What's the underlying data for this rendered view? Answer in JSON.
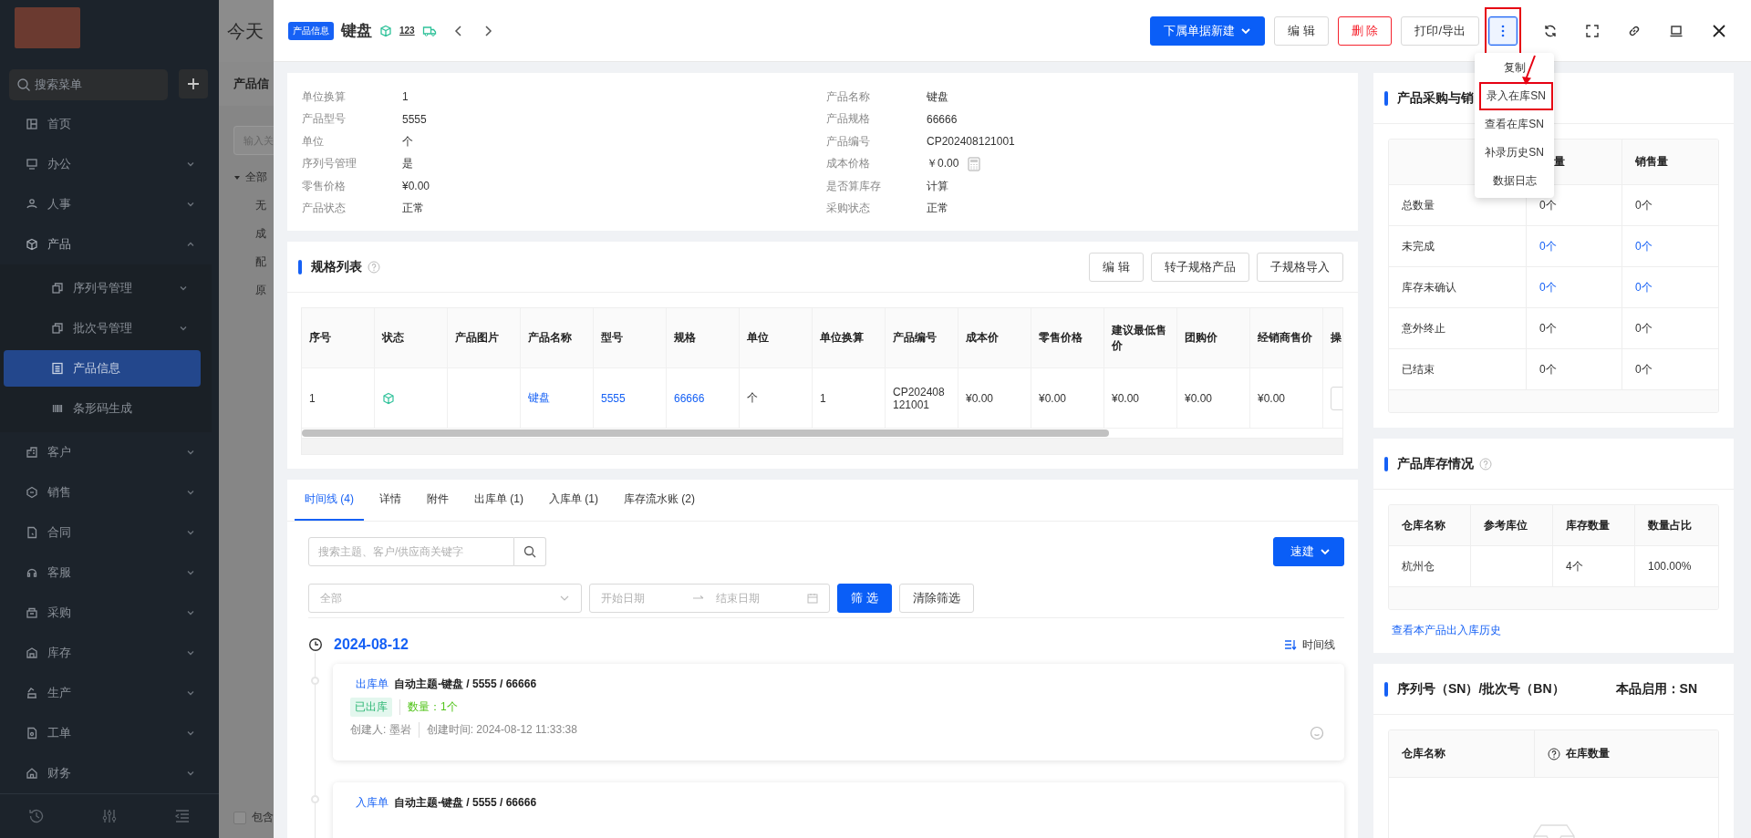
{
  "sidebar": {
    "search": {
      "placeholder": "搜索菜单"
    },
    "items": [
      {
        "label": "首页",
        "selected": false
      },
      {
        "label": "办公",
        "expanded": false,
        "selected": false
      },
      {
        "label": "人事",
        "expanded": false,
        "selected": false
      },
      {
        "label": "产品",
        "expanded": true,
        "selected": false,
        "children": [
          {
            "label": "序列号管理",
            "expanded": false,
            "selected": false
          },
          {
            "label": "批次号管理",
            "expanded": false,
            "selected": false
          },
          {
            "label": "产品信息",
            "selected": true
          },
          {
            "label": "条形码生成",
            "selected": false
          }
        ]
      },
      {
        "label": "客户",
        "expanded": false,
        "selected": false
      },
      {
        "label": "销售",
        "expanded": false,
        "selected": false
      },
      {
        "label": "合同",
        "expanded": false,
        "selected": false
      },
      {
        "label": "客服",
        "expanded": false,
        "selected": false
      },
      {
        "label": "采购",
        "expanded": false,
        "selected": false
      },
      {
        "label": "库存",
        "expanded": false,
        "selected": false
      },
      {
        "label": "生产",
        "expanded": false,
        "selected": false
      },
      {
        "label": "工单",
        "expanded": false,
        "selected": false
      },
      {
        "label": "财务",
        "expanded": false,
        "selected": false
      }
    ]
  },
  "background_page": {
    "title": "今天",
    "section": "产品信",
    "search": {
      "placeholder": "输入关"
    },
    "tree": {
      "label": "全部",
      "expanded": true,
      "children": [
        {
          "label": "无"
        },
        {
          "label": "成"
        },
        {
          "label": "配"
        },
        {
          "label": "原"
        }
      ]
    },
    "checkbox": {
      "label": "包含",
      "checked": false
    }
  },
  "drawer": {
    "header": {
      "tag": "产品信息",
      "title": "键盘",
      "code_badge": "123",
      "actions": [
        {
          "label": "下属单据新建",
          "kind": "primary-dropdown"
        },
        {
          "label": "编 辑",
          "kind": "default"
        },
        {
          "label": "删 除",
          "kind": "danger"
        },
        {
          "label": "打印/导出",
          "kind": "default"
        }
      ],
      "more": {
        "highlighted": true
      }
    },
    "more_menu": {
      "arrow": true,
      "items": [
        {
          "label": "复制",
          "highlighted": false
        },
        {
          "label": "录入在库SN",
          "highlighted": true
        },
        {
          "label": "查看在库SN",
          "highlighted": false
        },
        {
          "label": "补录历史SN",
          "highlighted": false
        },
        {
          "label": "数据日志",
          "highlighted": false
        }
      ]
    },
    "info": {
      "left": [
        {
          "label": "单位换算",
          "value": "1"
        },
        {
          "label": "产品型号",
          "value": "5555"
        },
        {
          "label": "单位",
          "value": "个"
        },
        {
          "label": "序列号管理",
          "value": "是"
        },
        {
          "label": "零售价格",
          "value": "¥0.00"
        },
        {
          "label": "产品状态",
          "value": "正常"
        }
      ],
      "right": [
        {
          "label": "产品名称",
          "value": "键盘"
        },
        {
          "label": "产品规格",
          "value": "66666"
        },
        {
          "label": "产品编号",
          "value": "CP202408121001"
        },
        {
          "label": "成本价格",
          "value": "￥0.00",
          "calculator": true
        },
        {
          "label": "是否算库存",
          "value": "计算"
        },
        {
          "label": "采购状态",
          "value": "正常"
        }
      ]
    },
    "spec_list": {
      "title": "规格列表",
      "buttons": [
        "编 辑",
        "转子规格产品",
        "子规格导入"
      ],
      "columns": [
        "序号",
        "状态",
        "产品图片",
        "产品名称",
        "型号",
        "规格",
        "单位",
        "单位换算",
        "产品编号",
        "成本价",
        "零售价格",
        "建议最低售价",
        "团购价",
        "经销商售价",
        "操"
      ],
      "rows": [
        [
          {
            "kind": "text",
            "text": "1"
          },
          {
            "kind": "status-icon"
          },
          {
            "kind": "empty"
          },
          {
            "kind": "link",
            "text": "键盘"
          },
          {
            "kind": "link",
            "text": "5555"
          },
          {
            "kind": "link",
            "text": "66666"
          },
          {
            "kind": "text",
            "text": "个"
          },
          {
            "kind": "text",
            "text": "1"
          },
          {
            "kind": "text",
            "text": "CP202408121001"
          },
          {
            "kind": "text",
            "text": "¥0.00"
          },
          {
            "kind": "text",
            "text": "¥0.00"
          },
          {
            "kind": "text",
            "text": "¥0.00"
          },
          {
            "kind": "text",
            "text": "¥0.00"
          },
          {
            "kind": "text",
            "text": "¥0.00"
          },
          {
            "kind": "button"
          }
        ]
      ]
    },
    "tabs": [
      {
        "label": "时间线 (4)",
        "selected": true
      },
      {
        "label": "详情",
        "selected": false
      },
      {
        "label": "附件",
        "selected": false
      },
      {
        "label": "出库单 (1)",
        "selected": false
      },
      {
        "label": "入库单 (1)",
        "selected": false
      },
      {
        "label": "库存流水账 (2)",
        "selected": false
      }
    ],
    "timeline": {
      "search": {
        "placeholder": "搜索主题、客户/供应商关键字"
      },
      "quick_create": "速建",
      "type_filter": {
        "placeholder": "全部"
      },
      "date_start": {
        "placeholder": "开始日期"
      },
      "date_end": {
        "placeholder": "结束日期"
      },
      "filter_button": "筛 选",
      "clear_button": "清除筛选",
      "date": "2024-08-12",
      "view_toggle": "时间线",
      "entries": [
        {
          "type_label": "出库单",
          "subject": "自动主题-键盘 / 5555 / 66666",
          "status": "已出库",
          "quantity": "数量：1个",
          "creator": "创建人: 墨岩",
          "created_at": "创建时间: 2024-08-12 11:33:38"
        },
        {
          "type_label": "入库单",
          "subject": "自动主题-键盘 / 5555 / 66666"
        }
      ]
    }
  },
  "purchase_sales": {
    "title": "产品采购与销",
    "columns": [
      "",
      "量",
      "销售量"
    ],
    "rows": [
      {
        "label": "总数量",
        "values": [
          {
            "text": "0个",
            "link": false
          },
          {
            "text": "0个",
            "link": false
          }
        ]
      },
      {
        "label": "未完成",
        "values": [
          {
            "text": "0个",
            "link": true
          },
          {
            "text": "0个",
            "link": true
          }
        ]
      },
      {
        "label": "库存未确认",
        "values": [
          {
            "text": "0个",
            "link": true
          },
          {
            "text": "0个",
            "link": true
          }
        ]
      },
      {
        "label": "意外终止",
        "values": [
          {
            "text": "0个",
            "link": false
          },
          {
            "text": "0个",
            "link": false
          }
        ]
      },
      {
        "label": "已结束",
        "values": [
          {
            "text": "0个",
            "link": false
          },
          {
            "text": "0个",
            "link": false
          }
        ]
      }
    ]
  },
  "stock": {
    "title": "产品库存情况",
    "columns": [
      "仓库名称",
      "参考库位",
      "库存数量",
      "数量占比"
    ],
    "rows": [
      [
        "杭州仓",
        "",
        "4个",
        "100.00%"
      ]
    ],
    "history_link": "查看本产品出入库历史"
  },
  "serial": {
    "title": "序列号（SN）/批次号（BN）",
    "enabled": "本品启用：SN",
    "columns": [
      "仓库名称",
      "在库数量"
    ]
  }
}
